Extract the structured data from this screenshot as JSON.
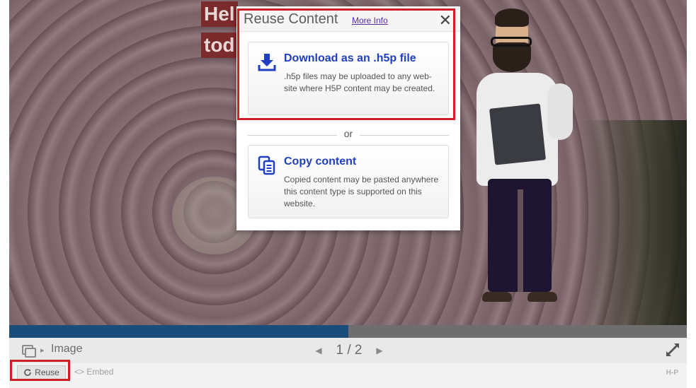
{
  "slide": {
    "banner_line1": "Hel",
    "banner_line2": "tod"
  },
  "progress": {
    "fraction": 0.5
  },
  "footer": {
    "label": "Image",
    "page_current": "1",
    "page_separator": "/",
    "page_total": "2"
  },
  "actions": {
    "reuse_label": "Reuse",
    "embed_label": "<> Embed",
    "logo_text": "H-P"
  },
  "dialog": {
    "title": "Reuse Content",
    "more_info": "More Info",
    "close_glyph": "✕",
    "divider_text": "or",
    "options": [
      {
        "title": "Download as an .h5p file",
        "description": ".h5p files may be uploaded to any web-site where H5P content may be created.",
        "icon": "download-icon"
      },
      {
        "title": "Copy content",
        "description": "Copied content may be pasted anywhere this content type is supported on this website.",
        "icon": "copy-icon"
      }
    ]
  },
  "colors": {
    "accent_link": "#1f3fc2",
    "highlight_border": "#cc1f2a",
    "progress_fill": "#1a4d7a"
  }
}
